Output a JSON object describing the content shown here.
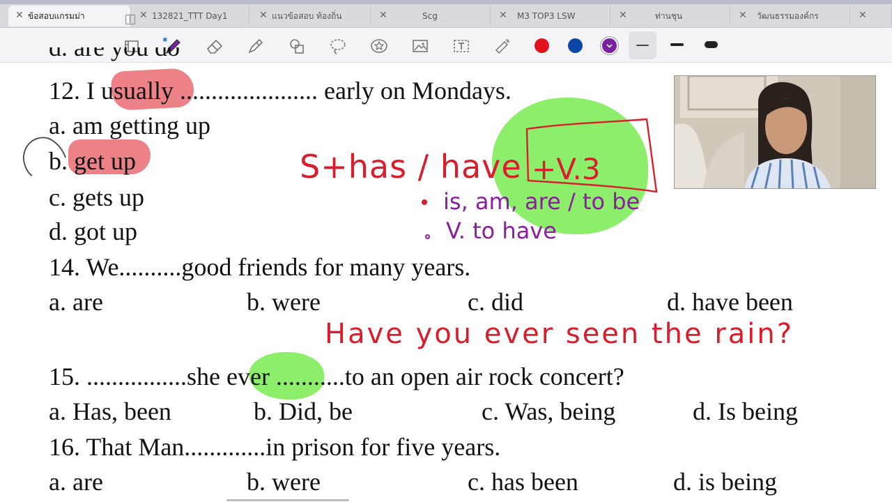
{
  "tabs": [
    {
      "label": "ข้อสอบแกรมม่า",
      "active": true
    },
    {
      "label": "132821_TTT Day1",
      "active": false
    },
    {
      "label": "แนวข้อสอบ ท้องถิ่น",
      "active": false
    },
    {
      "label": "Scg",
      "active": false
    },
    {
      "label": "M3 TOP3 LSW",
      "active": false
    },
    {
      "label": "ท่านชุน",
      "active": false
    },
    {
      "label": "วัฒนธรรมองค์กร",
      "active": false
    }
  ],
  "toolbar": {
    "tools": [
      "scan-icon",
      "pen-icon",
      "eraser-icon",
      "highlighter-icon",
      "shapes-icon",
      "lasso-icon",
      "sticker-icon",
      "image-icon",
      "text-icon",
      "laser-icon"
    ],
    "colors": [
      {
        "name": "red",
        "hex": "#e3131b"
      },
      {
        "name": "blue",
        "hex": "#0a47a8"
      },
      {
        "name": "purple",
        "hex": "#7b1fa2",
        "selected": true
      }
    ]
  },
  "document": {
    "partial_top": "d. are you do",
    "q12": "12. I usually ...................... early on Mondays.",
    "q12_a": "a. am getting up",
    "q12_b": "b. get up",
    "q12_c": "c. gets up",
    "q12_d": "d. got up",
    "q14": "14. We..........good friends for many years.",
    "q14_a": "a. are",
    "q14_b": "b. were",
    "q14_c": "c. did",
    "q14_d": "d. have been",
    "q15": "15. ................she ever ...........to an open air rock concert?",
    "q15_a": "a. Has, been",
    "q15_b": "b. Did, be",
    "q15_c": "c. Was, being",
    "q15_d": "d. Is being",
    "q16": "16. That Man.............in prison for five years.",
    "q16_a": "a. are",
    "q16_b": "b. were",
    "q16_c": "c. has been",
    "q16_d": "d. is being"
  },
  "annotations": {
    "formula": "S+has / have",
    "boxed": "+V.3",
    "bullet1": "is, am, are / to be",
    "bullet2": "V. to have",
    "sentence": "Have you ever seen the rain?"
  }
}
